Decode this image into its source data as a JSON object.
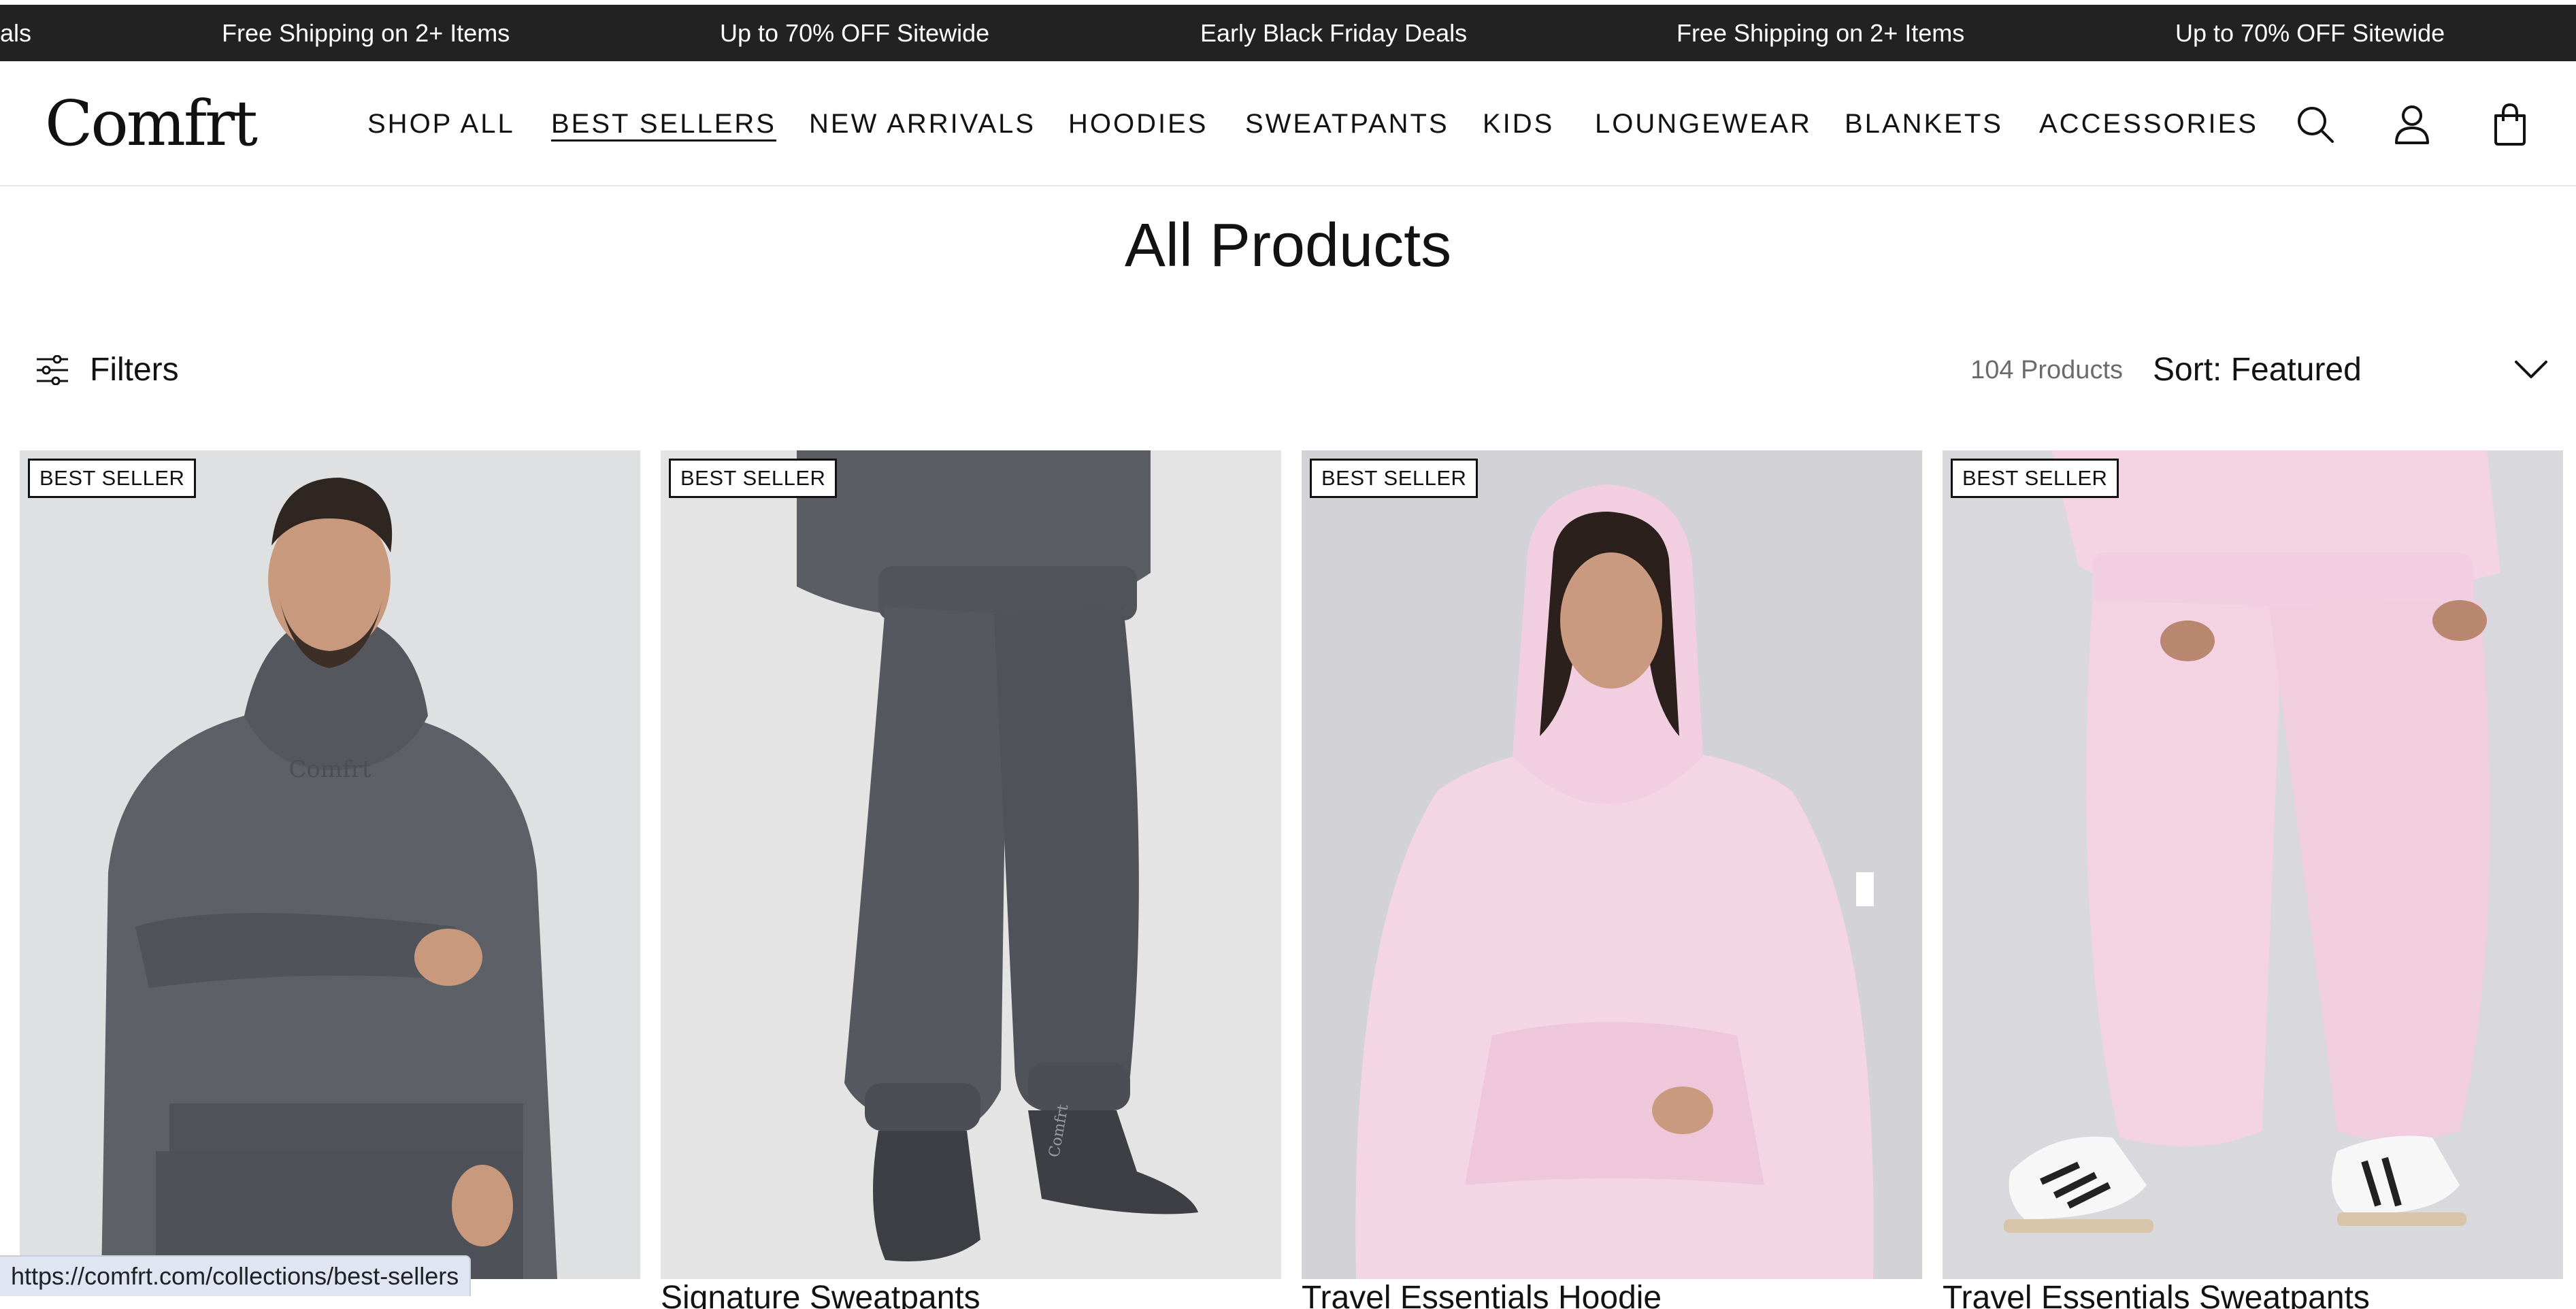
{
  "announcement": {
    "messages": [
      "als",
      "Free Shipping on 2+ Items",
      "Up to 70% OFF Sitewide",
      "Early Black Friday Deals",
      "Free Shipping on 2+ Items",
      "Up to 70% OFF Sitewide"
    ]
  },
  "header": {
    "logo": "Comfrt",
    "nav": [
      {
        "label": "SHOP ALL"
      },
      {
        "label": "BEST SELLERS",
        "active": true
      },
      {
        "label": "NEW ARRIVALS"
      },
      {
        "label": "HOODIES"
      },
      {
        "label": "SWEATPANTS"
      },
      {
        "label": "KIDS"
      },
      {
        "label": "LOUNGEWEAR"
      },
      {
        "label": "BLANKETS"
      },
      {
        "label": "ACCESSORIES"
      }
    ],
    "icons": [
      "search-icon",
      "account-icon",
      "cart-icon"
    ]
  },
  "page": {
    "title": "All Products"
  },
  "toolbar": {
    "filters_label": "Filters",
    "product_count": "104 Products",
    "sort_label": "Sort: Featured"
  },
  "products": [
    {
      "badge": "BEST SELLER",
      "title_peek": "",
      "image": "man-in-charcoal-hoodie",
      "color": "#5d6066"
    },
    {
      "badge": "BEST SELLER",
      "title_peek": "Signature Sweatpants",
      "image": "charcoal-sweatpants",
      "color": "#55585e"
    },
    {
      "badge": "BEST SELLER",
      "title_peek": "Travel Essentials Hoodie",
      "image": "woman-in-pink-hoodie",
      "color": "#f4d5e4"
    },
    {
      "badge": "BEST SELLER",
      "title_peek": "Travel Essentials Sweatpants",
      "image": "pink-sweatpants",
      "color": "#f3d3e2"
    }
  ],
  "status_bar": {
    "url": "https://comfrt.com/collections/best-sellers"
  }
}
